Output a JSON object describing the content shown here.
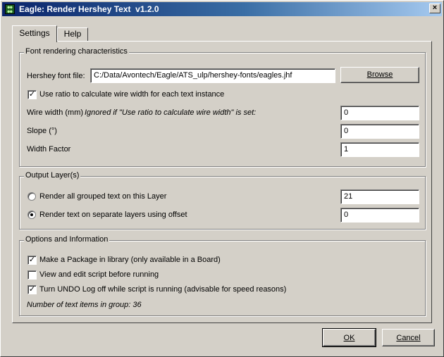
{
  "window": {
    "title": "Eagle: Render Hershey Text  v1.2.0"
  },
  "tabs": [
    {
      "label": "Settings",
      "active": true
    },
    {
      "label": "Help",
      "active": false
    }
  ],
  "font_group": {
    "legend": "Font rendering characteristics",
    "font_file_label": "Hershey font file:",
    "font_file_value": "C:/Data/Avontech/Eagle/ATS_ulp/hershey-fonts/eagles.jhf",
    "browse_label": "Browse",
    "ratio_checkbox_label": "Use ratio to calculate wire width for each text instance",
    "ratio_checked": true,
    "wire_width_label": "Wire width (mm)",
    "wire_width_note": "Ignored if \"Use ratio to calculate wire width\" is set:",
    "wire_width_value": "0",
    "slope_label": "Slope (°)",
    "slope_value": "0",
    "width_factor_label": "Width Factor",
    "width_factor_value": "1"
  },
  "output_group": {
    "legend": "Output Layer(s)",
    "option_grouped_label": "Render all grouped text on this Layer",
    "grouped_value": "21",
    "option_separate_label": "Render text on separate layers using offset",
    "separate_value": "0",
    "selected_option": "separate"
  },
  "options_group": {
    "legend": "Options and Information",
    "make_package_label": "Make a Package in library (only available in a Board)",
    "make_package_checked": true,
    "view_script_label": "View and edit script before running",
    "view_script_checked": false,
    "undo_label": "Turn UNDO Log off while script is running (advisable for speed reasons)",
    "undo_checked": true,
    "info_text": "Number of text items in group: 36"
  },
  "buttons": {
    "ok_label": "OK",
    "cancel_label": "Cancel"
  },
  "colors": {
    "titlebar_start": "#0a246a",
    "titlebar_end": "#a6caf0",
    "face": "#d4d0c8"
  }
}
